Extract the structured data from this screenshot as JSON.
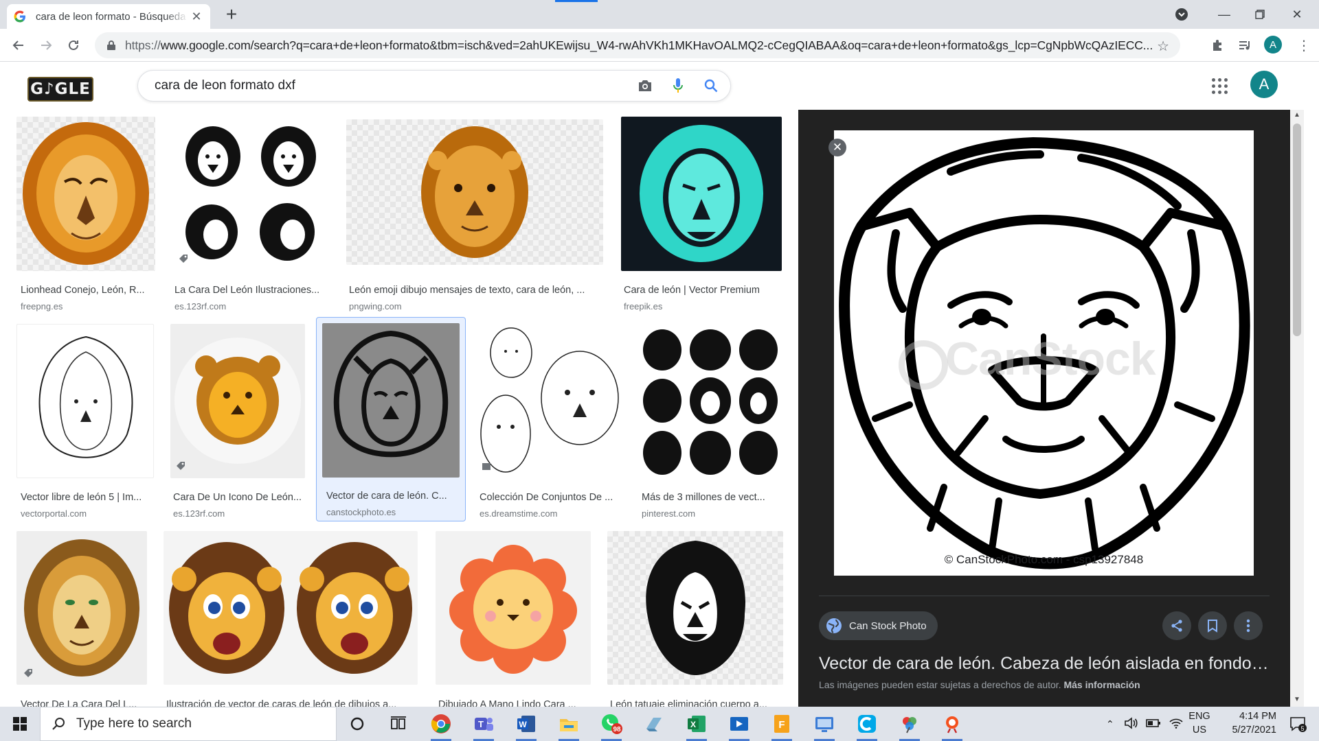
{
  "browser": {
    "tab": {
      "title": "cara de leon formato - Búsqueda de Google"
    },
    "url": {
      "scheme": "https://",
      "rest": "www.google.com/search?q=cara+de+leon+formato&tbm=isch&ved=2ahUKEwijsu_W4-rwAhVKh1MKHavOALMQ2-cCegQIABAA&oq=cara+de+leon+formato&gs_lcp=CgNpbWcQAzIECC..."
    },
    "profile_initial": "A"
  },
  "google": {
    "doodle_text": "G♪GLE",
    "search_query": "cara de leon formato dxf",
    "profile_initial": "A"
  },
  "results": [
    {
      "title": "Lionhead Conejo, León, R...",
      "source": "freepng.es"
    },
    {
      "title": "La Cara Del León Ilustraciones...",
      "source": "es.123rf.com"
    },
    {
      "title": "León emoji dibujo mensajes de texto, cara de león, ...",
      "source": "pngwing.com"
    },
    {
      "title": "Cara de león | Vector Premium",
      "source": "freepik.es"
    },
    {
      "title": "Vector libre de león 5 | Im...",
      "source": "vectorportal.com"
    },
    {
      "title": "Cara De Un Icono De León...",
      "source": "es.123rf.com"
    },
    {
      "title": "Vector de cara de león. C...",
      "source": "canstockphoto.es"
    },
    {
      "title": "Colección De Conjuntos De ...",
      "source": "es.dreamstime.com"
    },
    {
      "title": "Más de 3 millones de vect...",
      "source": "pinterest.com"
    },
    {
      "title": "Vector De La Cara Del L...",
      "source": ""
    },
    {
      "title": "Ilustración de vector de caras de león de dibujos a...",
      "source": ""
    },
    {
      "title": "Dibujado A Mano Lindo Cara ...",
      "source": ""
    },
    {
      "title": "León tatuaje eliminación cuerpo a...",
      "source": ""
    }
  ],
  "preview": {
    "watermark": "CanStock",
    "credit": "© CanStockPhoto.com - csp13927848",
    "source_name": "Can Stock Photo",
    "title": "Vector de cara de león. Cabeza de león aislada en fondo blanco",
    "note_prefix": "Las imágenes pueden estar sujetas a derechos de autor.",
    "note_link": "Más información"
  },
  "taskbar": {
    "search_placeholder": "Type here to search",
    "whatsapp_badge": "98",
    "lang_top": "ENG",
    "lang_bottom": "US",
    "time": "4:14 PM",
    "date": "5/27/2021",
    "notifications": "5"
  },
  "colors": {
    "accent": "#1a73e8",
    "profile": "#12858a",
    "preview_bg": "#222222",
    "selected_card": "#e8f0fe"
  }
}
